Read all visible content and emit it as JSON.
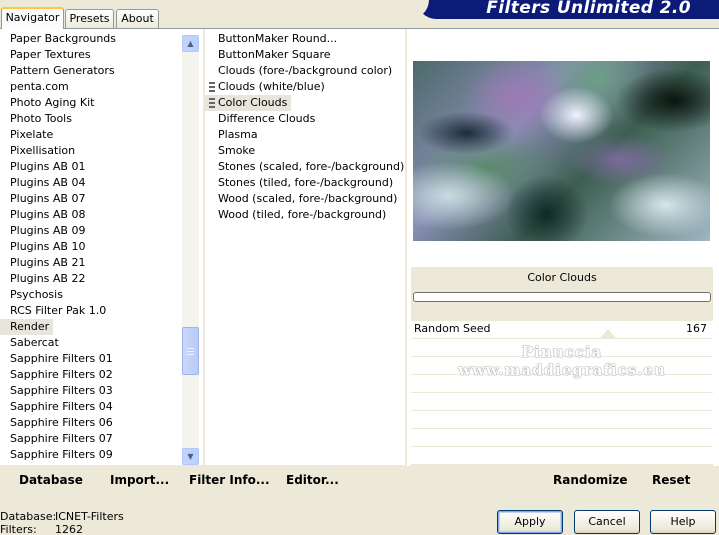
{
  "tabs": [
    {
      "label": "Navigator",
      "active": true
    },
    {
      "label": "Presets",
      "active": false
    },
    {
      "label": "About",
      "active": false
    }
  ],
  "app_title": "Filters Unlimited 2.0",
  "categories": {
    "items": [
      "Paper Backgrounds",
      "Paper Textures",
      "Pattern Generators",
      "penta.com",
      "Photo Aging Kit",
      "Photo Tools",
      "Pixelate",
      "Pixellisation",
      "Plugins AB 01",
      "Plugins AB 04",
      "Plugins AB 07",
      "Plugins AB 08",
      "Plugins AB 09",
      "Plugins AB 10",
      "Plugins AB 21",
      "Plugins AB 22",
      "Psychosis",
      "RCS Filter Pak 1.0",
      "Render",
      "Sabercat",
      "Sapphire Filters 01",
      "Sapphire Filters 02",
      "Sapphire Filters 03",
      "Sapphire Filters 04",
      "Sapphire Filters 06",
      "Sapphire Filters 07",
      "Sapphire Filters 09"
    ],
    "selected": "Render",
    "scroll_up_icon": "arrow-up-icon",
    "scroll_down_icon": "arrow-down-icon"
  },
  "filters": {
    "items": [
      {
        "label": "ButtonMaker Round...",
        "marked": false
      },
      {
        "label": "ButtonMaker Square",
        "marked": false
      },
      {
        "label": "Clouds (fore-/background color)",
        "marked": false
      },
      {
        "label": "Clouds (white/blue)",
        "marked": true
      },
      {
        "label": "Color Clouds",
        "marked": true
      },
      {
        "label": "Difference Clouds",
        "marked": false
      },
      {
        "label": "Plasma",
        "marked": false
      },
      {
        "label": "Smoke",
        "marked": false
      },
      {
        "label": "Stones (scaled, fore-/background)",
        "marked": false
      },
      {
        "label": "Stones (tiled, fore-/background)",
        "marked": false
      },
      {
        "label": "Wood (scaled, fore-/background)",
        "marked": false
      },
      {
        "label": "Wood (tiled, fore-/background)",
        "marked": false
      }
    ],
    "selected": "Color Clouds"
  },
  "preview": {
    "filter_name": "Color Clouds",
    "progress_fraction": 0
  },
  "params": [
    {
      "label": "Random Seed",
      "value": "167",
      "slider_fraction": 0.76
    }
  ],
  "watermark": {
    "line1": "Pinuccia",
    "line2": "www.maddiegrafics.eu"
  },
  "toolbar": {
    "database": "Database",
    "import": "Import...",
    "filter_info": "Filter Info...",
    "editor": "Editor...",
    "randomize": "Randomize",
    "reset": "Reset"
  },
  "footer": {
    "database_key": "Database:",
    "database_value": "ICNET-Filters",
    "filters_key": "Filters:",
    "filters_value": "1262"
  },
  "buttons": {
    "apply": "Apply",
    "cancel": "Cancel",
    "help": "Help"
  },
  "colors": {
    "title_banner": "#0c1a78",
    "dialog_bg": "#ece9d8",
    "active_tab_accent": "#ffc83c"
  }
}
